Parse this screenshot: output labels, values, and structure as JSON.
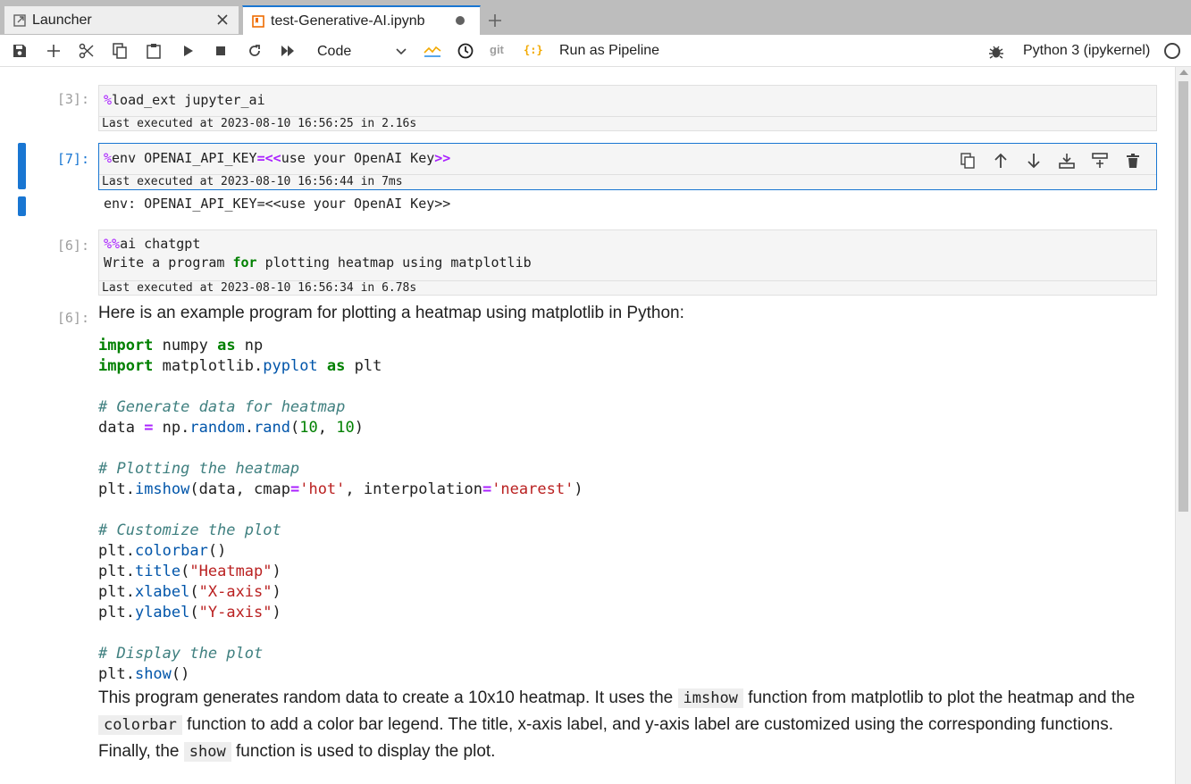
{
  "tabs": [
    {
      "label": "Launcher",
      "icon": "launcher-icon"
    },
    {
      "label": "test-Generative-AI.ipynb",
      "icon": "notebook-icon"
    }
  ],
  "toolbar": {
    "cell_type": "Code",
    "git_label": "git",
    "pipeline_icon": "{:}",
    "run_pipeline": "Run as Pipeline",
    "kernel": "Python 3 (ipykernel)"
  },
  "cells": {
    "c1": {
      "prompt": "[3]:",
      "magic": "%",
      "code": "load_ext jupyter_ai",
      "exec": "Last executed at 2023-08-10 16:56:25 in 2.16s"
    },
    "c2": {
      "prompt": "[7]:",
      "magic": "%",
      "code_a": "env OPENAI_API_KEY",
      "op1": "=<<",
      "code_b": "use your OpenAI Key",
      "op2": ">>",
      "exec": "Last executed at 2023-08-10 16:56:44 in 7ms",
      "output": "env: OPENAI_API_KEY=<<use your OpenAI Key>>"
    },
    "c3": {
      "prompt": "[6]:",
      "magic": "%%",
      "line1": "ai chatgpt",
      "line2_a": "Write a program ",
      "line2_kw": "for",
      "line2_b": " plotting heatmap using matplotlib",
      "exec": "Last executed at 2023-08-10 16:56:34 in 6.78s"
    },
    "c4": {
      "prompt": "[6]:",
      "intro": "Here is an example program for plotting a heatmap using matplotlib in Python:",
      "desc_1": "This program generates random data to create a 10x10 heatmap. It uses the ",
      "code_imshow": "imshow",
      "desc_2": " function from matplotlib to plot the heatmap and the ",
      "code_colorbar": "colorbar",
      "desc_3": " function to add a color bar legend. The title, x-axis label, and y-axis label are customized using the corresponding functions. Finally, the ",
      "code_show": "show",
      "desc_4": " function is used to display the plot."
    }
  },
  "code": {
    "import": "import",
    "as": "as",
    "numpy": " numpy ",
    "np": " np",
    "matplotlib": " matplotlib.",
    "pyplot": "pyplot",
    "plt": " plt",
    "c_generate": "# Generate data for heatmap",
    "data_eq": "data ",
    "eq": "=",
    "np_dot": " np.",
    "random": "random",
    "dot": ".",
    "rand": "rand",
    "open": "(",
    "ten": "10",
    "comma": ", ",
    "close": ")",
    "c_plotting": "# Plotting the heatmap",
    "plt_dot": "plt.",
    "imshow": "imshow",
    "imshow_args_a": "(data, cmap",
    "hot": "'hot'",
    "imshow_args_b": ", interpolation",
    "nearest": "'nearest'",
    "c_customize": "# Customize the plot",
    "colorbar": "colorbar",
    "empty_call": "()",
    "title": "title",
    "s_heatmap": "\"Heatmap\"",
    "xlabel": "xlabel",
    "s_xaxis": "\"X-axis\"",
    "ylabel": "ylabel",
    "s_yaxis": "\"Y-axis\"",
    "c_display": "# Display the plot",
    "show": "show"
  }
}
